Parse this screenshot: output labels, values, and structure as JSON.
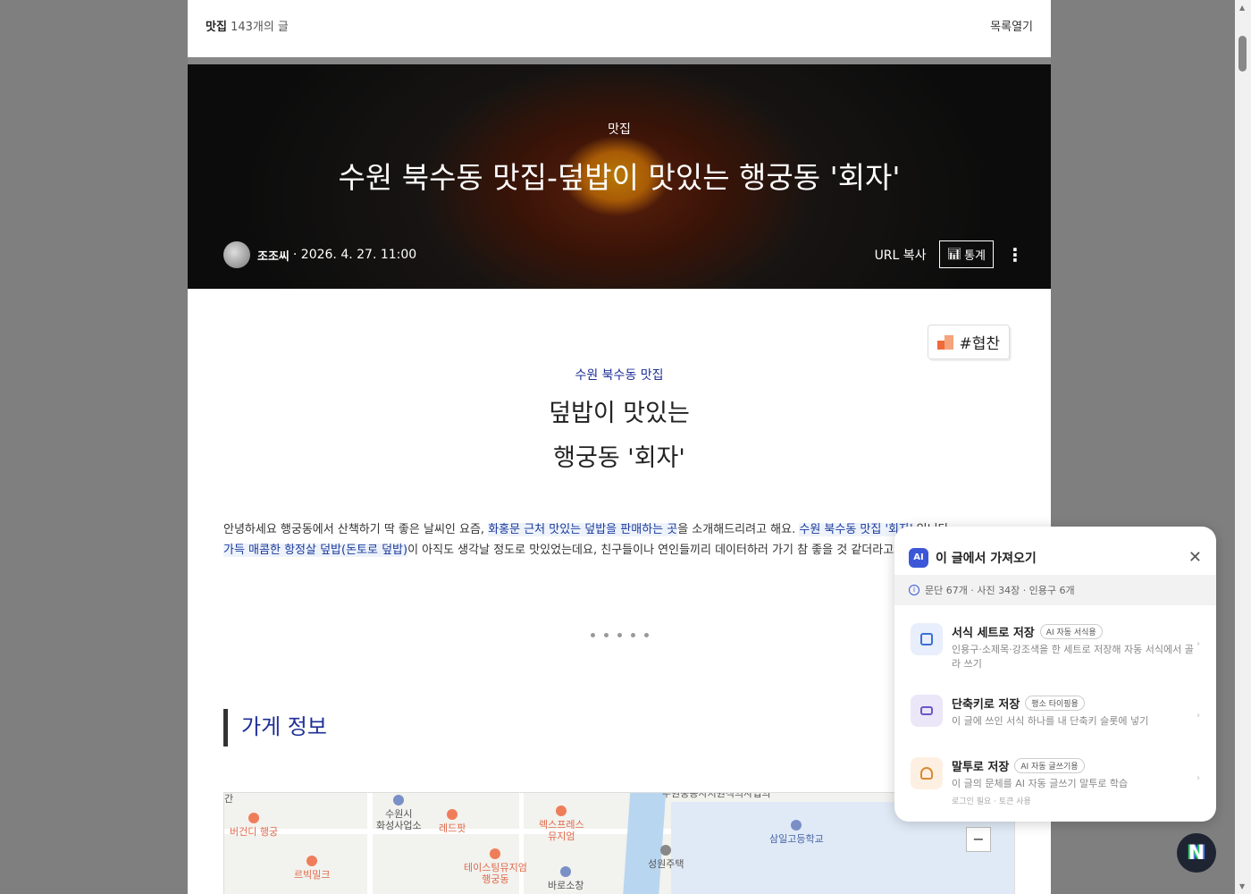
{
  "topbar": {
    "category": "맛집",
    "count": "143개의 글",
    "open_list": "목록열기"
  },
  "hero": {
    "category": "맛집",
    "title": "수원 북수동 맛집-덮밥이 맛있는 행궁동 '회자'",
    "author": "조조씨",
    "date": "· 2026. 4. 27. 11:00",
    "url_copy": "URL 복사",
    "stats": "통계"
  },
  "post": {
    "sponsor": "#협찬",
    "subtitle": "수원 북수동 맛집",
    "title_line1": "덮밥이 맛있는",
    "title_line2": "행궁동 '회자'",
    "p1_a": "안녕하세요 행궁동에서 산책하기 딱 좋은 날씨인 요즘, ",
    "p1_hl1": "화홍문 근처 맛있는 덮밥을 판매하는 곳",
    "p1_b": "을 소개해드리려고 해요. ",
    "p1_hl2": "수원 북수동 맛집 '회자'",
    "p1_c": " 입니다.",
    "p2_hl": "가득 매콤한 항정살 덮밥(돈토로 덮밥)",
    "p2_a": "이 아직도 생각날 정도로 맛있었는데요, 친구들이나 연인들끼리 데이터하러 가기 참 좋을 것 같더라고요~ 그럼",
    "section_title": "가게 정보"
  },
  "map": {
    "labels": {
      "burgundy": "버건디 행궁",
      "hwaseong": "수원시\n화성사업소",
      "redpot": "레드팟",
      "express": "렉스프레스\n뮤지엄",
      "tasting": "테이스팅뮤지엄\n행궁동",
      "bebemilk": "르빅밀크",
      "baro": "바로소창",
      "seongwon": "성원주택",
      "samil": "삼일고등학교",
      "top": "수원중동사지원직의사업의",
      "gan": "간"
    },
    "zoom_out": "−"
  },
  "ai_panel": {
    "badge": "AI",
    "title": "이 글에서 가져오기",
    "info": "문단 67개 · 사진 34장 · 인용구 6개",
    "items": [
      {
        "name": "서식 세트로 저장",
        "tag": "AI 자동 서식용",
        "desc": "인용구·소제목·강조색을 한 세트로 저장해 자동 서식에서 골라 쓰기"
      },
      {
        "name": "단축키로 저장",
        "tag": "평소 타이핑용",
        "desc": "이 글에 쓰인 서식 하나를 내 단축키 슬롯에 넣기"
      },
      {
        "name": "말투로 저장",
        "tag": "AI 자동 글쓰기용",
        "desc": "이 글의 문체를 AI 자동 글쓰기 말투로 학습",
        "sub": "로그인 필요 · 토큰 사용"
      }
    ]
  },
  "floating": {
    "label": "N"
  },
  "colors": {
    "accent": "#1e2f97",
    "ai_blue": "#3b57d8"
  }
}
